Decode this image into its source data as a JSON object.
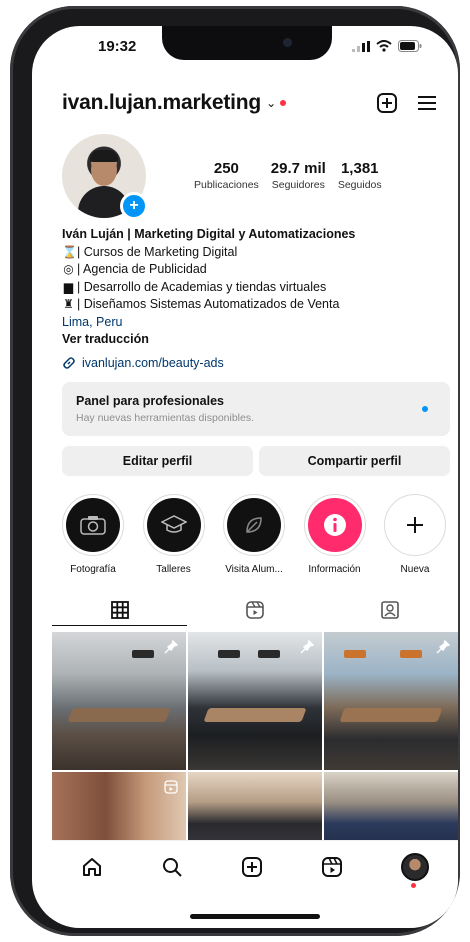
{
  "status": {
    "time": "19:32"
  },
  "header": {
    "username": "ivan.lujan.marketing"
  },
  "stats": [
    {
      "value": "250",
      "label": "Publicaciones"
    },
    {
      "value": "29.7 mil",
      "label": "Seguidores"
    },
    {
      "value": "1,381",
      "label": "Seguidos"
    }
  ],
  "bio": {
    "name": "Iván Luján | Marketing Digital y Automatizaciones",
    "lines": [
      "| Cursos de Marketing Digital",
      "| Agencia de Publicidad",
      "| Desarrollo de Academias y tiendas virtuales",
      "| Diseñamos Sistemas Automatizados de Venta"
    ],
    "location": "Lima, Peru",
    "translate": "Ver traducción",
    "link": "ivanlujan.com/beauty-ads"
  },
  "pro_panel": {
    "title": "Panel para profesionales",
    "subtitle": "Hay nuevas herramientas disponibles."
  },
  "buttons": {
    "edit": "Editar perfil",
    "share": "Compartir perfil"
  },
  "highlights": [
    {
      "label": "Fotografía",
      "icon": "camera-icon"
    },
    {
      "label": "Talleres",
      "icon": "graduation-cap-icon"
    },
    {
      "label": "Visita Alum...",
      "icon": "leaf-icon"
    },
    {
      "label": "Información",
      "icon": "info-icon"
    },
    {
      "label": "Nueva",
      "icon": "plus-icon"
    }
  ],
  "tabs": [
    "grid-icon",
    "reels-icon",
    "tagged-icon"
  ],
  "colors": {
    "accent": "#0095f6",
    "notification": "#ff3040",
    "highlight_pink": "#ff2b6d"
  }
}
